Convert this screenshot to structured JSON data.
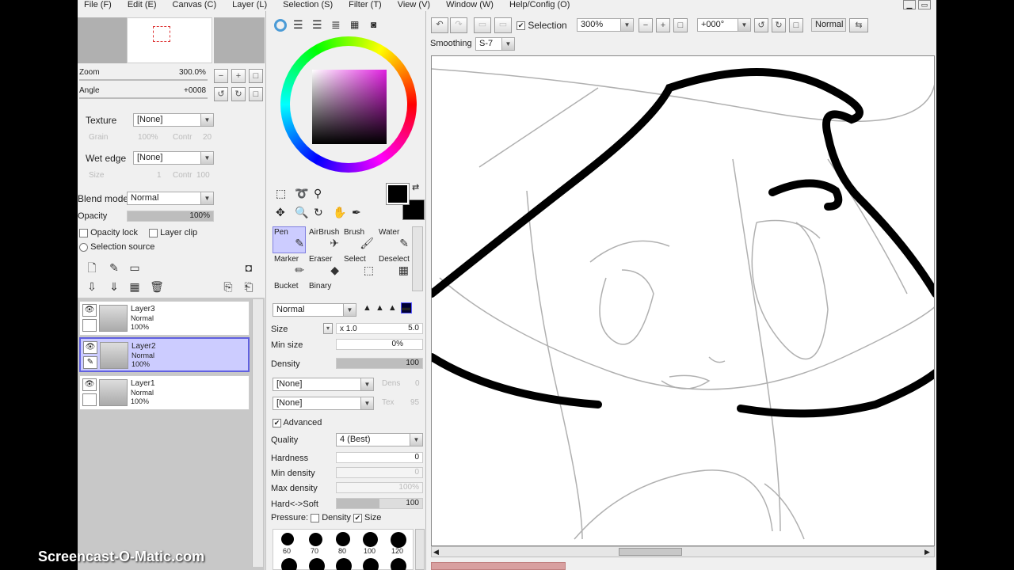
{
  "menu": [
    "File (F)",
    "Edit (E)",
    "Canvas (C)",
    "Layer (L)",
    "Selection (S)",
    "Filter (T)",
    "View (V)",
    "Window (W)",
    "Help/Config (O)"
  ],
  "navigator": {
    "zoom_label": "Zoom",
    "zoom_value": "300.0%",
    "angle_label": "Angle",
    "angle_value": "+0008"
  },
  "texture": {
    "label": "Texture",
    "value": "[None]",
    "grain_label": "Grain",
    "grain_value": "100%",
    "contr_label": "Contr",
    "contr_value": "20"
  },
  "wet_edge": {
    "label": "Wet edge",
    "value": "[None]",
    "size_label": "Size",
    "size_value": "1",
    "contr_label": "Contr",
    "contr_value": "100"
  },
  "blend": {
    "label": "Blend mode",
    "value": "Normal"
  },
  "opacity": {
    "label": "Opacity",
    "value": "100%",
    "fraction": 1.0
  },
  "opacity_lock": "Opacity lock",
  "layer_clip": "Layer clip",
  "selection_source": "Selection source",
  "layers": [
    {
      "name": "Layer3",
      "mode": "Normal",
      "opacity": "100%",
      "selected": false
    },
    {
      "name": "Layer2",
      "mode": "Normal",
      "opacity": "100%",
      "selected": true
    },
    {
      "name": "Layer1",
      "mode": "Normal",
      "opacity": "100%",
      "selected": false
    }
  ],
  "tools": [
    {
      "label": "Pen",
      "icon": "pen-icon",
      "selected": true
    },
    {
      "label": "AirBrush",
      "icon": "airbrush-icon",
      "selected": false
    },
    {
      "label": "Brush",
      "icon": "brush-icon",
      "selected": false
    },
    {
      "label": "Water",
      "icon": "water-icon",
      "selected": false
    },
    {
      "label": "Marker",
      "icon": "marker-icon",
      "selected": false
    },
    {
      "label": "Eraser",
      "icon": "eraser-icon",
      "selected": false
    },
    {
      "label": "Select",
      "icon": "select-icon",
      "selected": false
    },
    {
      "label": "Deselect",
      "icon": "deselect-icon",
      "selected": false
    },
    {
      "label": "Bucket",
      "icon": "bucket-icon",
      "selected": false
    },
    {
      "label": "Binary",
      "icon": "binary-icon",
      "selected": false
    }
  ],
  "brush": {
    "mode": "Normal",
    "size_label": "Size",
    "size_mult": "x 1.0",
    "size_value": "5.0",
    "min_size_label": "Min size",
    "min_size_value": "0%",
    "density_label": "Density",
    "density_value": "100",
    "density_fraction": 1.0,
    "shape": "[None]",
    "shape_dens_label": "Dens",
    "shape_dens_value": "0",
    "texture": "[None]",
    "tex_label": "Tex",
    "tex_value": "95",
    "advanced_label": "Advanced",
    "quality_label": "Quality",
    "quality_value": "4 (Best)",
    "hardness_label": "Hardness",
    "hardness_value": "0",
    "min_density_label": "Min density",
    "min_density_value": "0",
    "max_density_label": "Max density",
    "max_density_value": "100%",
    "hard_soft_label": "Hard<->Soft",
    "hard_soft_value": "100",
    "hard_soft_fraction": 0.5,
    "pressure_label": "Pressure:",
    "pressure_density": "Density",
    "pressure_size": "Size"
  },
  "brush_sizes": [
    "60",
    "70",
    "80",
    "100",
    "120"
  ],
  "toolbar": {
    "selection_label": "Selection",
    "zoom_value": "300%",
    "angle_value": "+000°",
    "mode_value": "Normal",
    "smoothing_label": "Smoothing",
    "smoothing_value": "S-7"
  },
  "colors": {
    "primary": "#000000",
    "secondary": "#000000",
    "selected_layer": "#ccccff"
  },
  "watermark": "Screencast-O-Matic.com"
}
